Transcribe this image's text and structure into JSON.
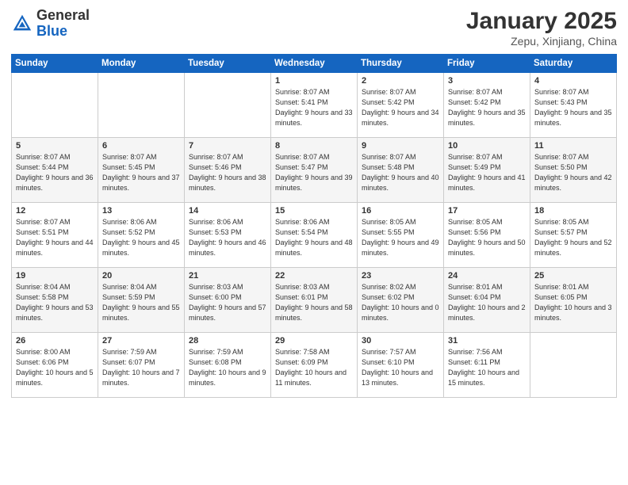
{
  "header": {
    "logo_general": "General",
    "logo_blue": "Blue",
    "month": "January 2025",
    "location": "Zepu, Xinjiang, China"
  },
  "weekdays": [
    "Sunday",
    "Monday",
    "Tuesday",
    "Wednesday",
    "Thursday",
    "Friday",
    "Saturday"
  ],
  "weeks": [
    [
      {
        "day": "",
        "info": ""
      },
      {
        "day": "",
        "info": ""
      },
      {
        "day": "",
        "info": ""
      },
      {
        "day": "1",
        "info": "Sunrise: 8:07 AM\nSunset: 5:41 PM\nDaylight: 9 hours\nand 33 minutes."
      },
      {
        "day": "2",
        "info": "Sunrise: 8:07 AM\nSunset: 5:42 PM\nDaylight: 9 hours\nand 34 minutes."
      },
      {
        "day": "3",
        "info": "Sunrise: 8:07 AM\nSunset: 5:42 PM\nDaylight: 9 hours\nand 35 minutes."
      },
      {
        "day": "4",
        "info": "Sunrise: 8:07 AM\nSunset: 5:43 PM\nDaylight: 9 hours\nand 35 minutes."
      }
    ],
    [
      {
        "day": "5",
        "info": "Sunrise: 8:07 AM\nSunset: 5:44 PM\nDaylight: 9 hours\nand 36 minutes."
      },
      {
        "day": "6",
        "info": "Sunrise: 8:07 AM\nSunset: 5:45 PM\nDaylight: 9 hours\nand 37 minutes."
      },
      {
        "day": "7",
        "info": "Sunrise: 8:07 AM\nSunset: 5:46 PM\nDaylight: 9 hours\nand 38 minutes."
      },
      {
        "day": "8",
        "info": "Sunrise: 8:07 AM\nSunset: 5:47 PM\nDaylight: 9 hours\nand 39 minutes."
      },
      {
        "day": "9",
        "info": "Sunrise: 8:07 AM\nSunset: 5:48 PM\nDaylight: 9 hours\nand 40 minutes."
      },
      {
        "day": "10",
        "info": "Sunrise: 8:07 AM\nSunset: 5:49 PM\nDaylight: 9 hours\nand 41 minutes."
      },
      {
        "day": "11",
        "info": "Sunrise: 8:07 AM\nSunset: 5:50 PM\nDaylight: 9 hours\nand 42 minutes."
      }
    ],
    [
      {
        "day": "12",
        "info": "Sunrise: 8:07 AM\nSunset: 5:51 PM\nDaylight: 9 hours\nand 44 minutes."
      },
      {
        "day": "13",
        "info": "Sunrise: 8:06 AM\nSunset: 5:52 PM\nDaylight: 9 hours\nand 45 minutes."
      },
      {
        "day": "14",
        "info": "Sunrise: 8:06 AM\nSunset: 5:53 PM\nDaylight: 9 hours\nand 46 minutes."
      },
      {
        "day": "15",
        "info": "Sunrise: 8:06 AM\nSunset: 5:54 PM\nDaylight: 9 hours\nand 48 minutes."
      },
      {
        "day": "16",
        "info": "Sunrise: 8:05 AM\nSunset: 5:55 PM\nDaylight: 9 hours\nand 49 minutes."
      },
      {
        "day": "17",
        "info": "Sunrise: 8:05 AM\nSunset: 5:56 PM\nDaylight: 9 hours\nand 50 minutes."
      },
      {
        "day": "18",
        "info": "Sunrise: 8:05 AM\nSunset: 5:57 PM\nDaylight: 9 hours\nand 52 minutes."
      }
    ],
    [
      {
        "day": "19",
        "info": "Sunrise: 8:04 AM\nSunset: 5:58 PM\nDaylight: 9 hours\nand 53 minutes."
      },
      {
        "day": "20",
        "info": "Sunrise: 8:04 AM\nSunset: 5:59 PM\nDaylight: 9 hours\nand 55 minutes."
      },
      {
        "day": "21",
        "info": "Sunrise: 8:03 AM\nSunset: 6:00 PM\nDaylight: 9 hours\nand 57 minutes."
      },
      {
        "day": "22",
        "info": "Sunrise: 8:03 AM\nSunset: 6:01 PM\nDaylight: 9 hours\nand 58 minutes."
      },
      {
        "day": "23",
        "info": "Sunrise: 8:02 AM\nSunset: 6:02 PM\nDaylight: 10 hours\nand 0 minutes."
      },
      {
        "day": "24",
        "info": "Sunrise: 8:01 AM\nSunset: 6:04 PM\nDaylight: 10 hours\nand 2 minutes."
      },
      {
        "day": "25",
        "info": "Sunrise: 8:01 AM\nSunset: 6:05 PM\nDaylight: 10 hours\nand 3 minutes."
      }
    ],
    [
      {
        "day": "26",
        "info": "Sunrise: 8:00 AM\nSunset: 6:06 PM\nDaylight: 10 hours\nand 5 minutes."
      },
      {
        "day": "27",
        "info": "Sunrise: 7:59 AM\nSunset: 6:07 PM\nDaylight: 10 hours\nand 7 minutes."
      },
      {
        "day": "28",
        "info": "Sunrise: 7:59 AM\nSunset: 6:08 PM\nDaylight: 10 hours\nand 9 minutes."
      },
      {
        "day": "29",
        "info": "Sunrise: 7:58 AM\nSunset: 6:09 PM\nDaylight: 10 hours\nand 11 minutes."
      },
      {
        "day": "30",
        "info": "Sunrise: 7:57 AM\nSunset: 6:10 PM\nDaylight: 10 hours\nand 13 minutes."
      },
      {
        "day": "31",
        "info": "Sunrise: 7:56 AM\nSunset: 6:11 PM\nDaylight: 10 hours\nand 15 minutes."
      },
      {
        "day": "",
        "info": ""
      }
    ]
  ]
}
